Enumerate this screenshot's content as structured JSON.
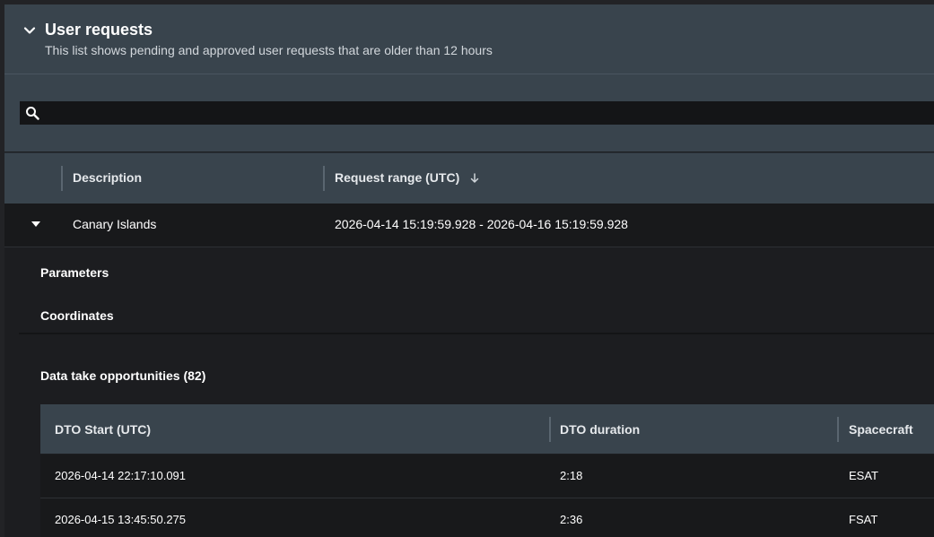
{
  "header": {
    "title": "User requests",
    "subtitle": "This list shows pending and approved user requests that are older than 12 hours"
  },
  "search": {
    "value": "",
    "icon": "search-icon"
  },
  "table": {
    "columns": {
      "description": "Description",
      "request_range": "Request range (UTC)"
    },
    "sort": {
      "column": "request_range",
      "direction": "descending"
    },
    "rows": [
      {
        "description": "Canary Islands",
        "request_range": "2026-04-14 15:19:59.928 - 2026-04-16 15:19:59.928",
        "expanded": true
      }
    ]
  },
  "details": {
    "parameters_label": "Parameters",
    "coordinates_label": "Coordinates",
    "dto_title": "Data take opportunities",
    "dto_count": "(82)",
    "dto_columns": {
      "start": "DTO Start (UTC)",
      "duration": "DTO duration",
      "spacecraft": "Spacecraft"
    },
    "dto_rows": [
      {
        "start": "2026-04-14 22:17:10.091",
        "duration": "2:18",
        "spacecraft": "ESAT"
      },
      {
        "start": "2026-04-15 13:45:50.275",
        "duration": "2:36",
        "spacecraft": "FSAT"
      }
    ]
  },
  "colors": {
    "header_bg": "#39444d",
    "body_bg": "#1c1d20",
    "text": "#ffffff"
  }
}
